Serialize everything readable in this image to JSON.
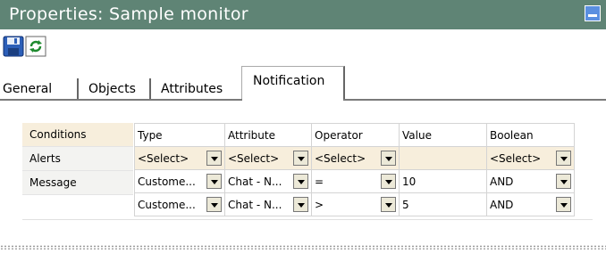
{
  "window": {
    "title": "Properties: Sample monitor"
  },
  "toolbar": {
    "save_icon": "save-disk-icon",
    "refresh_icon": "refresh-icon"
  },
  "tabs": [
    {
      "label": "General"
    },
    {
      "label": "Objects"
    },
    {
      "label": "Attributes"
    },
    {
      "label": "Notification",
      "active": true
    }
  ],
  "side": {
    "items": [
      {
        "label": "Conditions",
        "selected": true
      },
      {
        "label": "Alerts"
      },
      {
        "label": "Message"
      }
    ]
  },
  "grid": {
    "headers": [
      "Type",
      "Attribute",
      "Operator",
      "Value",
      "Boolean"
    ],
    "rows": [
      {
        "type": "<Select>",
        "attribute": "<Select>",
        "operator": "<Select>",
        "value": "",
        "boolean": "<Select>"
      },
      {
        "type": "Custome...",
        "attribute": "Chat - N...",
        "operator": "=",
        "value": "10",
        "boolean": "AND"
      },
      {
        "type": "Custome...",
        "attribute": "Chat - N...",
        "operator": ">",
        "value": "5",
        "boolean": "AND"
      }
    ]
  },
  "colors": {
    "titlebar": "#5f8475",
    "selected_row": "#f7eedc"
  }
}
